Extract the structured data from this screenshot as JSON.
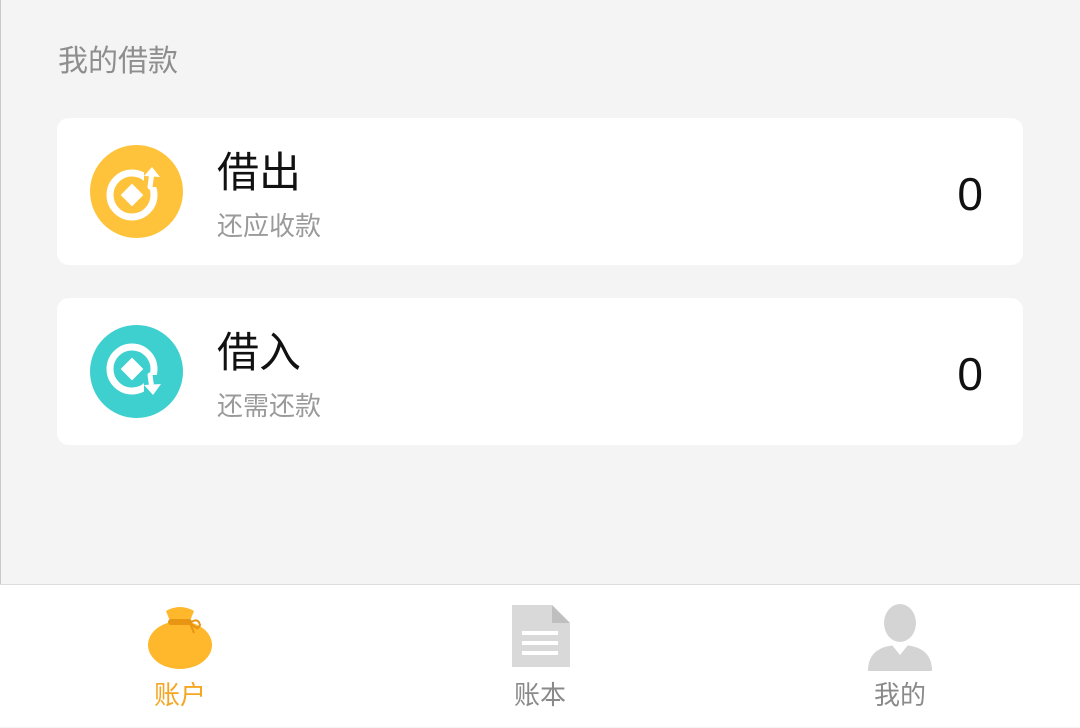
{
  "section": {
    "title": "我的借款"
  },
  "cards": {
    "lend": {
      "title": "借出",
      "subtitle": "还应收款",
      "amount": "0",
      "icon": "coin-arrow-up-icon",
      "color": "#fec33a"
    },
    "borrow": {
      "title": "借入",
      "subtitle": "还需还款",
      "amount": "0",
      "icon": "coin-arrow-down-icon",
      "color": "#3ecfcf"
    }
  },
  "tabbar": {
    "active_color": "#f5a623",
    "inactive_color": "#8a8a8a",
    "tabs": [
      {
        "label": "账户",
        "icon": "money-bag-icon",
        "active": true
      },
      {
        "label": "账本",
        "icon": "document-icon",
        "active": false
      },
      {
        "label": "我的",
        "icon": "user-icon",
        "active": false
      }
    ]
  }
}
